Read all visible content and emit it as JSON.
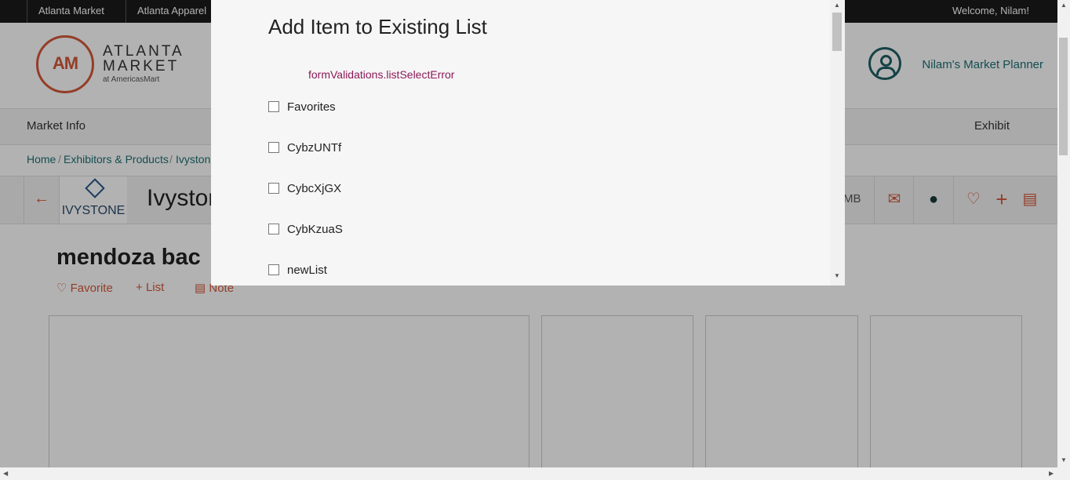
{
  "topbar": {
    "tabs": [
      "Atlanta Market",
      "Atlanta Apparel"
    ],
    "welcome": "Welcome, Nilam!"
  },
  "header": {
    "logo_initials": "AM",
    "logo_line1": "ATLANTA",
    "logo_line2": "MARKET",
    "logo_sub": "at AmericasMart",
    "planner": "Nilam's Market Planner"
  },
  "nav": {
    "left": "Market Info",
    "right": "Exhibit"
  },
  "breadcrumb": {
    "home": "Home",
    "sep": "/",
    "exhibitors": "Exhibitors & Products",
    "current": "Ivyston"
  },
  "exhibitor": {
    "logo_word": "IVYSTONE",
    "name": "Ivystone",
    "size_label": "MB"
  },
  "product": {
    "title": "mendoza bac",
    "favorite": "Favorite",
    "list": "List",
    "note": "Note"
  },
  "modal": {
    "title": "Add Item to Existing List",
    "error": "formValidations.listSelectError",
    "lists": [
      "Favorites",
      "CybzUNTf",
      "CybcXjGX",
      "CybKzuaS",
      "newList"
    ]
  },
  "colors": {
    "accent": "#d4583a",
    "teal": "#1f6f73",
    "error": "#8b1a5a"
  }
}
